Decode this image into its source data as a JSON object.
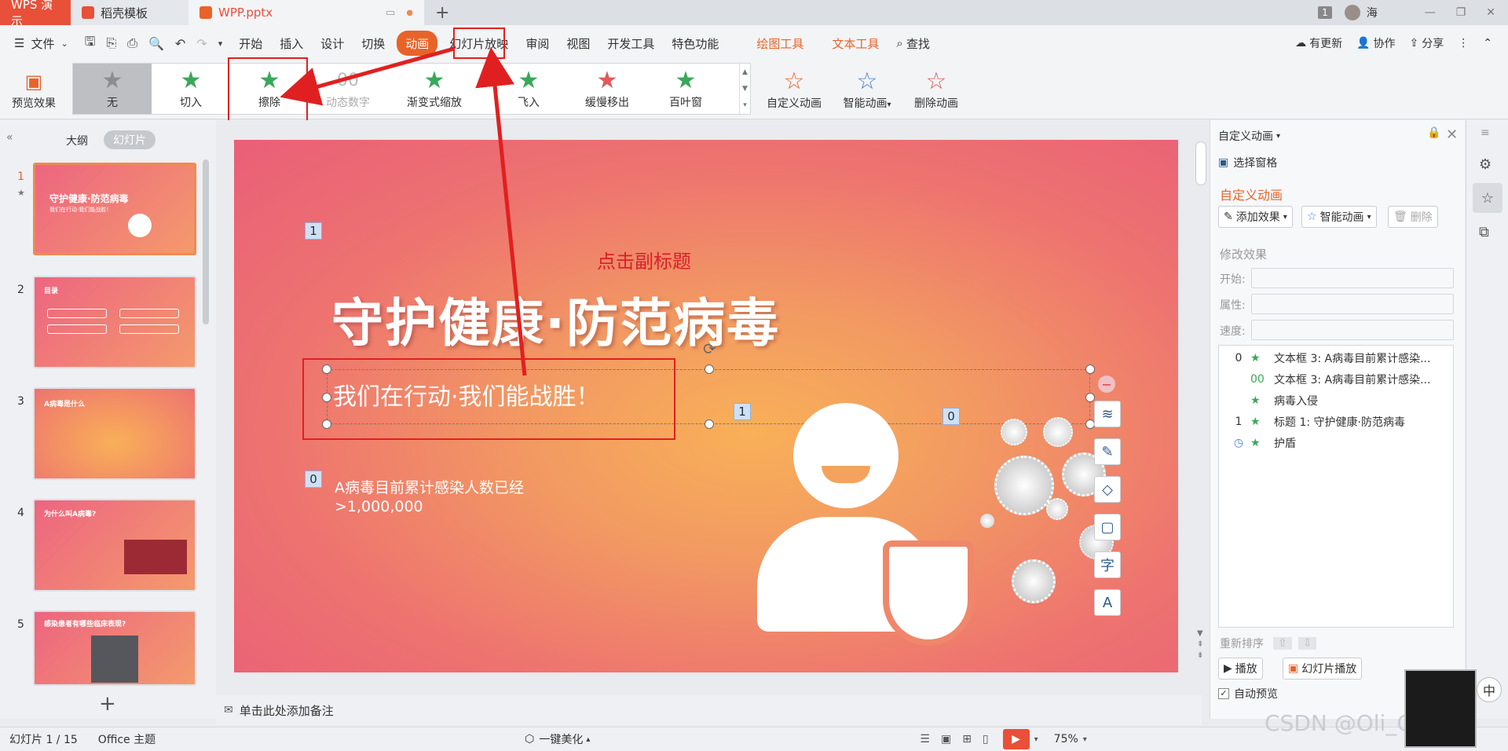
{
  "titlebar": {
    "wps_tab": "WPS 演示",
    "doc_tab": "稻壳模板",
    "file_tab": "WPP.pptx",
    "add_tab": "+",
    "page_badge": "1",
    "user": "海"
  },
  "menubar": {
    "file": "文件",
    "items": [
      "开始",
      "插入",
      "设计",
      "切换",
      "动画",
      "幻灯片放映",
      "审阅",
      "视图",
      "开发工具",
      "特色功能"
    ],
    "tools": [
      "绘图工具",
      "文本工具"
    ],
    "search": "查找",
    "update": "有更新",
    "collab": "协作",
    "share": "分享"
  },
  "ribbon": {
    "preview": "预览效果",
    "gallery": [
      "无",
      "切入",
      "擦除",
      "动态数字",
      "渐变式缩放",
      "飞入",
      "缓慢移出",
      "百叶窗"
    ],
    "custom_anim": "自定义动画",
    "smart_anim": "智能动画",
    "delete_anim": "删除动画"
  },
  "leftpanel": {
    "outline_tab": "大纲",
    "slides_tab": "幻灯片",
    "thumbnails": [
      {
        "num": "1",
        "title": "守护健康·防范病毒",
        "sub": "我们在行动·我们能战胜！"
      },
      {
        "num": "2",
        "title": "目录",
        "sub": ""
      },
      {
        "num": "3",
        "title": "A病毒是什么",
        "sub": ""
      },
      {
        "num": "4",
        "title": "为什么叫A病毒?",
        "sub": ""
      },
      {
        "num": "5",
        "title": "感染患者有哪些临床表现?",
        "sub": ""
      }
    ],
    "add_slide": "+"
  },
  "slide": {
    "subtitle_placeholder": "点击副标题",
    "title": "守护健康·防范病毒",
    "tagline": "我们在行动·我们能战胜！",
    "stat_line1": "A病毒目前累计感染人数已经",
    "stat_line2": ">1,000,000",
    "badges": [
      "1",
      "1",
      "0",
      "0"
    ]
  },
  "notes": {
    "placeholder": "单击此处添加备注"
  },
  "rightpanel": {
    "header": "自定义动画",
    "select_pane": "选择窗格",
    "section_title": "自定义动画",
    "add_effect": "添加效果",
    "smart_anim": "智能动画",
    "delete": "删除",
    "modify_title": "修改效果",
    "start_label": "开始:",
    "property_label": "属性:",
    "speed_label": "速度:",
    "animations": [
      {
        "order": "0",
        "name": "文本框 3: A病毒目前累计感染..."
      },
      {
        "order": "",
        "name": "文本框 3: A病毒目前累计感染..."
      },
      {
        "order": "",
        "name": "病毒入侵"
      },
      {
        "order": "1",
        "name": "标题 1: 守护健康·防范病毒"
      },
      {
        "order": "",
        "name": "护盾"
      }
    ],
    "reorder": "重新排序",
    "play": "播放",
    "slideshow": "幻灯片播放",
    "auto_preview": "自动预览"
  },
  "statusbar": {
    "slide_info": "幻灯片 1 / 15",
    "theme": "Office 主题",
    "beautify": "一键美化",
    "zoom": "75%",
    "watermark": "CSDN @Oli_Corre",
    "ime": "中"
  },
  "colors": {
    "accent": "#e8632a",
    "red_annotation": "#e02020",
    "slide_pink": "#e95f78",
    "slide_orange": "#f9b058"
  }
}
